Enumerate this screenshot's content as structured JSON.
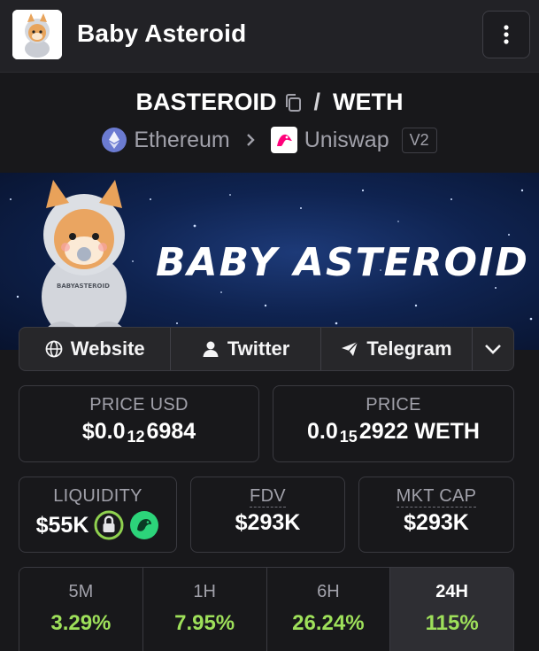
{
  "header": {
    "title": "Baby Asteroid",
    "avatar_icon": "shiba-astronaut-avatar",
    "menu_icon": "more-vertical-icon"
  },
  "pair": {
    "base": "BASTEROID",
    "separator": "/",
    "quote": "WETH",
    "copy_icon": "copy-icon"
  },
  "chain": {
    "network": "Ethereum",
    "dex": "Uniswap",
    "version": "V2"
  },
  "banner": {
    "title": "BABY ASTEROID",
    "suit_text": "BABYASTEROID"
  },
  "links": [
    {
      "label": "Website",
      "icon": "globe-icon"
    },
    {
      "label": "Twitter",
      "icon": "user-icon"
    },
    {
      "label": "Telegram",
      "icon": "send-icon"
    }
  ],
  "stats": {
    "price_usd": {
      "label": "PRICE USD",
      "prefix": "$0.0",
      "zeros": "12",
      "digits": "6984"
    },
    "price_native": {
      "label": "PRICE",
      "prefix": "0.0",
      "zeros": "15",
      "digits": "2922 WETH"
    },
    "liquidity": {
      "label": "LIQUIDITY",
      "value": "$55K"
    },
    "fdv": {
      "label": "FDV",
      "value": "$293K"
    },
    "mkt_cap": {
      "label": "MKT CAP",
      "value": "$293K"
    }
  },
  "timeframes": [
    {
      "label": "5M",
      "value": "3.29%"
    },
    {
      "label": "1H",
      "value": "7.95%"
    },
    {
      "label": "6H",
      "value": "26.24%"
    },
    {
      "label": "24H",
      "value": "115%",
      "active": true
    }
  ],
  "colors": {
    "positive": "#9ee05a",
    "background": "#18181b",
    "panel": "#222226"
  }
}
